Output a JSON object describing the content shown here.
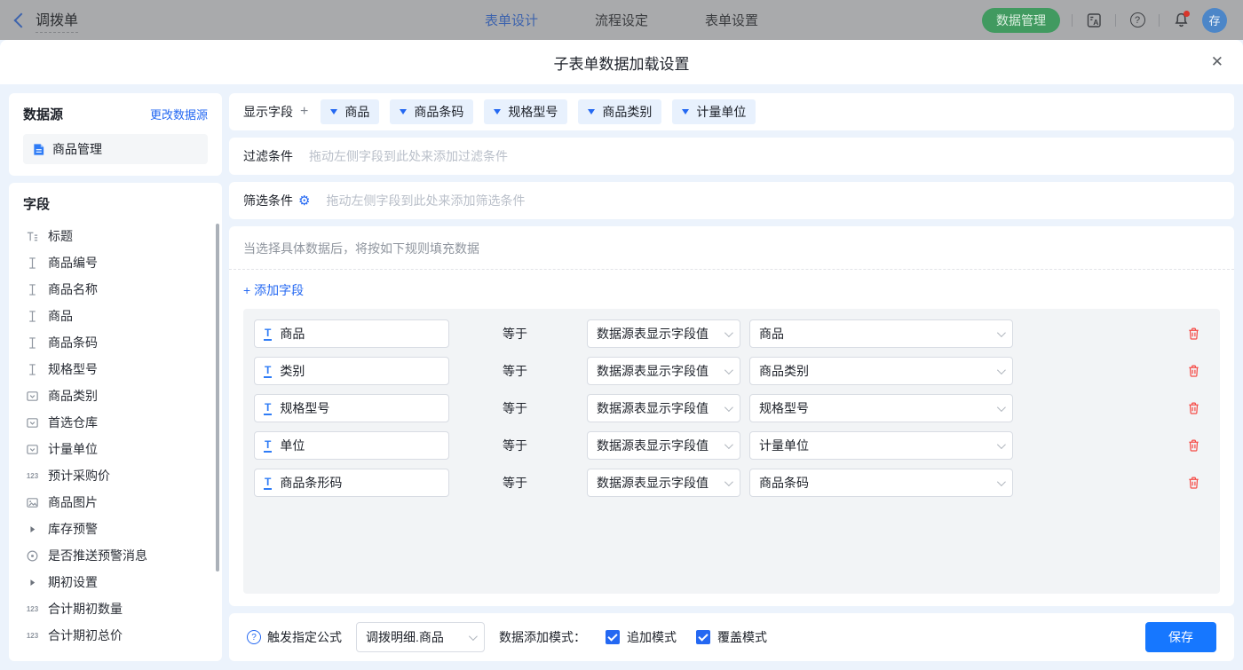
{
  "colors": {
    "primary": "#2468f2",
    "save_button": "#1677ff",
    "danger": "#f54a45",
    "manage_button": "#419a60",
    "avatar": "#4c86c8",
    "tag_bg": "#e8f1fd"
  },
  "topbar": {
    "back_title": "调拨单",
    "tabs": [
      {
        "label": "表单设计",
        "active": true
      },
      {
        "label": "流程设定",
        "active": false
      },
      {
        "label": "表单设置",
        "active": false
      }
    ],
    "manage_button": "数据管理",
    "help_glyph": "?",
    "avatar_text": "存"
  },
  "modal": {
    "title": "子表单数据加载设置",
    "close_icon": "✕"
  },
  "sidebar": {
    "datasource": {
      "title": "数据源",
      "change_link": "更改数据源",
      "item": "商品管理"
    },
    "fields": {
      "title": "字段",
      "items": [
        {
          "icon": "title-icon",
          "label": "标题"
        },
        {
          "icon": "text-icon",
          "label": "商品编号"
        },
        {
          "icon": "text-icon",
          "label": "商品名称"
        },
        {
          "icon": "text-icon",
          "label": "商品"
        },
        {
          "icon": "text-icon",
          "label": "商品条码"
        },
        {
          "icon": "text-icon",
          "label": "规格型号"
        },
        {
          "icon": "select-icon",
          "label": "商品类别"
        },
        {
          "icon": "select-icon",
          "label": "首选仓库"
        },
        {
          "icon": "select-icon",
          "label": "计量单位"
        },
        {
          "icon": "number-icon",
          "label": "预计采购价",
          "number_glyph": "123"
        },
        {
          "icon": "image-icon",
          "label": "商品图片"
        },
        {
          "icon": "group-icon",
          "label": "库存预警"
        },
        {
          "icon": "radio-icon",
          "label": "是否推送预警消息"
        },
        {
          "icon": "group-icon",
          "label": "期初设置"
        },
        {
          "icon": "number-icon",
          "label": "合计期初数量",
          "number_glyph": "123"
        },
        {
          "icon": "number-icon",
          "label": "合计期初总价",
          "number_glyph": "123"
        }
      ]
    }
  },
  "main": {
    "display_fields": {
      "label": "显示字段",
      "add_glyph": "+",
      "tags": [
        "商品",
        "商品条码",
        "规格型号",
        "商品类别",
        "计量单位"
      ]
    },
    "filter": {
      "label": "过滤条件",
      "placeholder": "拖动左侧字段到此处来添加过滤条件"
    },
    "sift": {
      "label": "筛选条件",
      "gear_glyph": "⚙",
      "placeholder": "拖动左侧字段到此处来添加筛选条件"
    },
    "rules": {
      "hint": "当选择具体数据后，将按如下规则填充数据",
      "add_field_link": "+ 添加字段",
      "text_field_glyph": "T",
      "rows": [
        {
          "field": "商品",
          "operator": "等于",
          "source_type": "数据源表显示字段值",
          "source_field": "商品"
        },
        {
          "field": "类别",
          "operator": "等于",
          "source_type": "数据源表显示字段值",
          "source_field": "商品类别"
        },
        {
          "field": "规格型号",
          "operator": "等于",
          "source_type": "数据源表显示字段值",
          "source_field": "规格型号"
        },
        {
          "field": "单位",
          "operator": "等于",
          "source_type": "数据源表显示字段值",
          "source_field": "计量单位"
        },
        {
          "field": "商品条形码",
          "operator": "等于",
          "source_type": "数据源表显示字段值",
          "source_field": "商品条码"
        }
      ]
    },
    "footer": {
      "help_glyph": "?",
      "trigger_label": "触发指定公式",
      "trigger_value": "调拨明细.商品",
      "mode_label": "数据添加模式：",
      "modes": [
        {
          "label": "追加模式",
          "checked": true
        },
        {
          "label": "覆盖模式",
          "checked": true
        }
      ],
      "save_label": "保存"
    }
  }
}
